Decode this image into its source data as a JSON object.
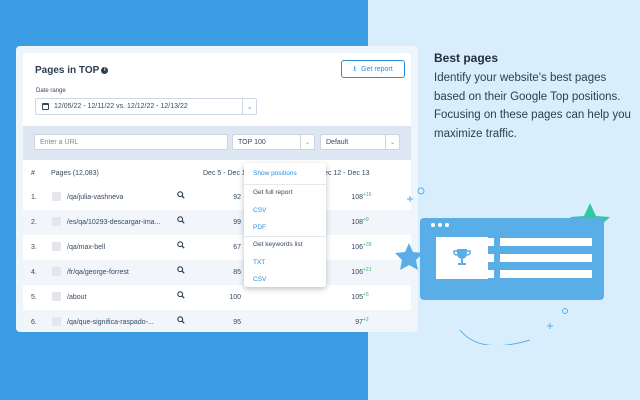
{
  "side": {
    "title": "Best pages",
    "description": "Identify your website's best pages based on their Google Top positions. Focusing on these pages can help you maximize traffic."
  },
  "panel": {
    "title": "Pages in TOP",
    "report_button": "Get report",
    "date_label": "Date range",
    "date_value": "12/05/22 - 12/11/22 vs. 12/12/22 - 12/13/22"
  },
  "filters": {
    "url_placeholder": "Enter a URL",
    "top_value": "TOP 100",
    "sort_value": "Default"
  },
  "table": {
    "headers": {
      "num": "#",
      "pages": "Pages (12,083)",
      "period1": "Dec 5 - Dec 11",
      "period2": "Dec 12 - Dec 13"
    },
    "rows": [
      {
        "num": "1.",
        "page": "/qa/julia-vashneva",
        "v1": "92",
        "v2": "108",
        "delta": "+16"
      },
      {
        "num": "2.",
        "page": "/es/qa/10293-descargar-ima...",
        "v1": "99",
        "v2": "108",
        "delta": "+9"
      },
      {
        "num": "3.",
        "page": "/qa/max-bell",
        "v1": "67",
        "v2": "106",
        "delta": "+39"
      },
      {
        "num": "4.",
        "page": "/fr/qa/george-forrest",
        "v1": "85",
        "v2": "106",
        "delta": "+21"
      },
      {
        "num": "5.",
        "page": "/about",
        "v1": "100",
        "v2": "105",
        "delta": "+5"
      },
      {
        "num": "6.",
        "page": "/qa/que-significa-raspado-...",
        "v1": "95",
        "v2": "97",
        "delta": "+2"
      }
    ]
  },
  "menu": {
    "items": [
      "Show positions",
      "Get full report",
      "CSV",
      "PDF",
      "Get keywords list",
      "TXT",
      "CSV"
    ]
  },
  "colors": {
    "accent": "#2d8ed8",
    "positive": "#2eb85c",
    "background_left": "#3b9ee5"
  }
}
